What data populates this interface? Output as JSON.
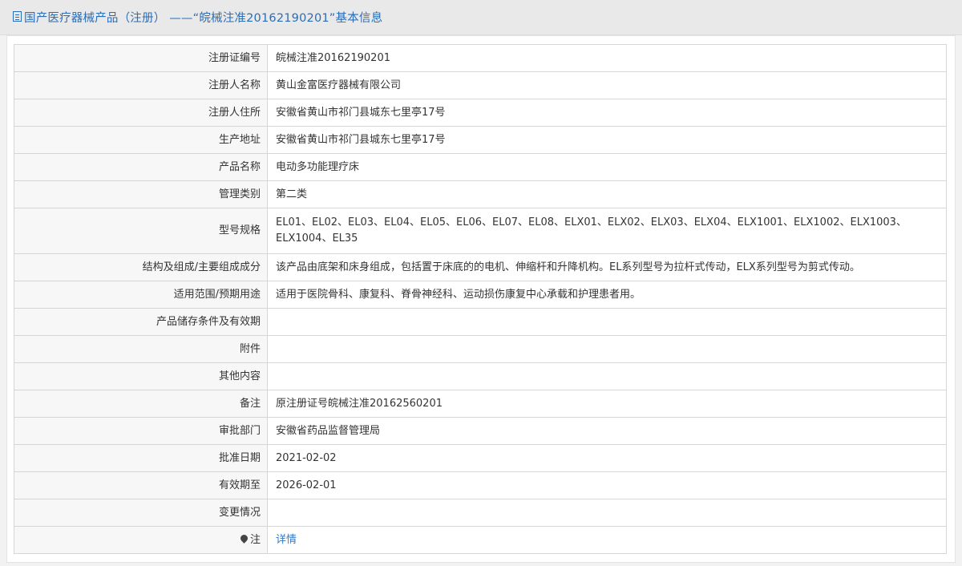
{
  "header": {
    "title": "国产医疗器械产品（注册） ——“皖械注准20162190201”基本信息"
  },
  "rows": [
    {
      "label": "注册证编号",
      "value": "皖械注准20162190201"
    },
    {
      "label": "注册人名称",
      "value": "黄山金富医疗器械有限公司"
    },
    {
      "label": "注册人住所",
      "value": "安徽省黄山市祁门县城东七里亭17号"
    },
    {
      "label": "生产地址",
      "value": "安徽省黄山市祁门县城东七里亭17号"
    },
    {
      "label": "产品名称",
      "value": "电动多功能理疗床"
    },
    {
      "label": "管理类别",
      "value": "第二类"
    },
    {
      "label": "型号规格",
      "value": "EL01、EL02、EL03、EL04、EL05、EL06、EL07、EL08、ELX01、ELX02、ELX03、ELX04、ELX1001、ELX1002、ELX1003、ELX1004、EL35"
    },
    {
      "label": "结构及组成/主要组成成分",
      "value": "该产品由底架和床身组成，包括置于床底的的电机、伸缩杆和升降机构。EL系列型号为拉杆式传动，ELX系列型号为剪式传动。"
    },
    {
      "label": "适用范围/预期用途",
      "value": "适用于医院骨科、康复科、脊骨神经科、运动损伤康复中心承载和护理患者用。"
    },
    {
      "label": "产品储存条件及有效期",
      "value": ""
    },
    {
      "label": "附件",
      "value": ""
    },
    {
      "label": "其他内容",
      "value": ""
    },
    {
      "label": "备注",
      "value": "原注册证号皖械注准20162560201"
    },
    {
      "label": "审批部门",
      "value": "安徽省药品监督管理局"
    },
    {
      "label": "批准日期",
      "value": "2021-02-02"
    },
    {
      "label": "有效期至",
      "value": "2026-02-01"
    },
    {
      "label": "变更情况",
      "value": ""
    },
    {
      "label": "注",
      "value": "详情"
    }
  ],
  "icons": {
    "header": "document-icon",
    "note": "pin-icon"
  },
  "colors": {
    "link": "#2a7ad0",
    "header_text": "#2a6db8"
  }
}
